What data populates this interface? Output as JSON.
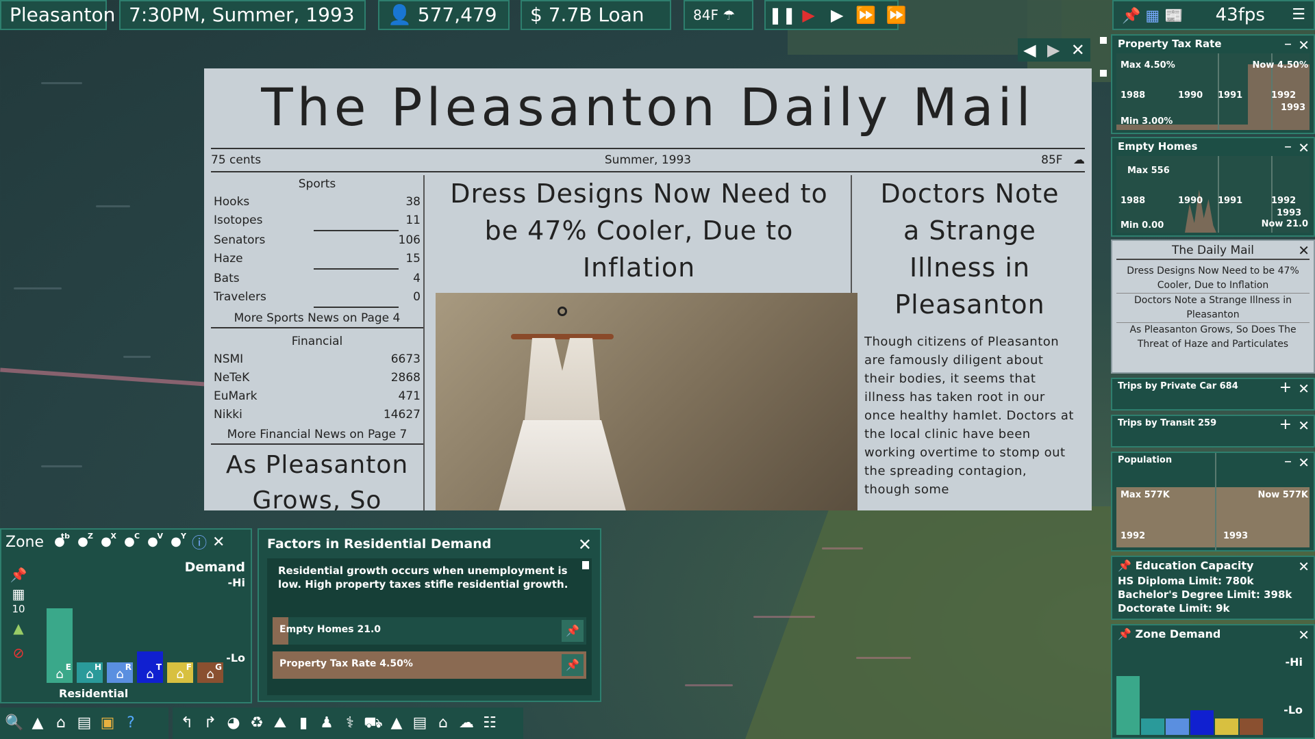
{
  "topbar": {
    "city": "Pleasanton",
    "datetime": "7:30PM, Summer, 1993",
    "population": "577,479",
    "money": "7.7B Loan",
    "temperature": "84F",
    "fps": "43fps"
  },
  "newspaper": {
    "masthead": "The Pleasanton Daily Mail",
    "price": "75 cents",
    "date": "Summer, 1993",
    "temperature": "85F",
    "sports_heading": "Sports",
    "sports": [
      {
        "team": "Hooks",
        "score": "38"
      },
      {
        "team": "Isotopes",
        "score": "11"
      },
      {
        "team": "Senators",
        "score": "106"
      },
      {
        "team": "Haze",
        "score": "15"
      },
      {
        "team": "Bats",
        "score": "4"
      },
      {
        "team": "Travelers",
        "score": "0"
      }
    ],
    "more_sports": "More Sports News on Page 4",
    "financial_heading": "Financial",
    "financial": [
      {
        "name": "NSMI",
        "value": "6673"
      },
      {
        "name": "NeTeK",
        "value": "2868"
      },
      {
        "name": "EuMark",
        "value": "471"
      },
      {
        "name": "Nikki",
        "value": "14627"
      }
    ],
    "more_financial": "More Financial News on Page 7",
    "col1_headline": "As Pleasanton Grows, So",
    "main_headline": "Dress Designs Now Need to be 47% Cooler, Due to Inflation",
    "side_headline": "Doctors Note a Strange Illness in Pleasanton",
    "side_story": "Though citizens of Pleasanton are famously diligent about their bodies, it seems that illness has taken root in our once healthy hamlet. Doctors at the local clinic have been working overtime to stomp out the spreading contagion, though some"
  },
  "right_panels": {
    "property_tax": {
      "title": "Property Tax Rate",
      "max": "Max 4.50%",
      "min": "Min 3.00%",
      "now": "Now 4.50%",
      "years": [
        "1988",
        "1990",
        "1991",
        "1992",
        "1993"
      ]
    },
    "empty_homes": {
      "title": "Empty Homes",
      "max": "Max 556",
      "min": "Min 0.00",
      "now": "Now 21.0",
      "years": [
        "1988",
        "1990",
        "1991",
        "1992",
        "1993"
      ]
    },
    "daily_mail": {
      "title": "The Daily Mail",
      "items": [
        "Dress Designs Now Need to be 47% Cooler, Due to Inflation",
        "Doctors Note a Strange Illness in Pleasanton",
        "As Pleasanton Grows, So Does The Threat of Haze and Particulates"
      ]
    },
    "trips_car": {
      "title": "Trips by Private Car 684"
    },
    "trips_transit": {
      "title": "Trips by Transit 259"
    },
    "population": {
      "title": "Population",
      "max": "Max 577K",
      "now": "Now 577K",
      "years": [
        "1992",
        "1993"
      ]
    },
    "education": {
      "title": "Education Capacity",
      "lines": [
        "HS Diploma Limit: 780k",
        "Bachelor's Degree Limit: 398k",
        "Doctorate Limit: 9k"
      ]
    },
    "zone_demand": {
      "title": "Zone Demand",
      "hi": "-Hi",
      "lo": "-Lo"
    }
  },
  "zone_panel": {
    "title": "Zone",
    "demand_label": "Demand",
    "hi": "-Hi",
    "lo": "-Lo",
    "count": "10",
    "residential": "Residential",
    "bars": [
      {
        "letter": "E",
        "color": "#3aa88a",
        "level": 0.72
      },
      {
        "letter": "H",
        "color": "#2a9a9a",
        "level": 0.2
      },
      {
        "letter": "R",
        "color": "#5a8fe0",
        "level": 0.2
      },
      {
        "letter": "T",
        "color": "#1020d0",
        "level": 0.3
      },
      {
        "letter": "F",
        "color": "#d8c040",
        "level": 0.2
      },
      {
        "letter": "G",
        "color": "#8a5030",
        "level": 0.2
      }
    ],
    "hotkeys": [
      "tb",
      "Z",
      "X",
      "C",
      "V",
      "Y"
    ]
  },
  "factors": {
    "title": "Factors in Residential Demand",
    "description": "Residential growth occurs when unemployment is low. High property taxes stifle residential growth.",
    "rows": [
      {
        "label": "Empty Homes 21.0",
        "fill": 0.05
      },
      {
        "label": "Property Tax Rate 4.50%",
        "fill": 1.0
      }
    ]
  },
  "bottom_toolbar": {
    "keys": [
      "1",
      "2",
      "3",
      "4",
      "5"
    ]
  }
}
